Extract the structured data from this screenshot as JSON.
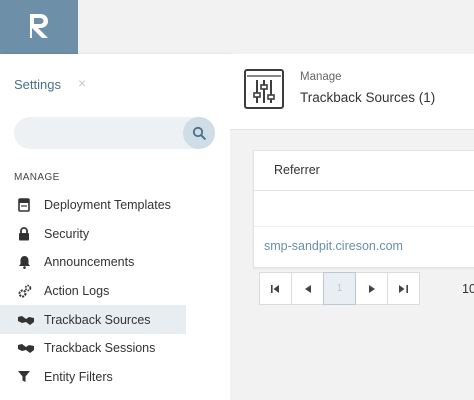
{
  "app": {
    "logo_icon": "r-logo-icon",
    "brand_color": "#6d8fa8"
  },
  "sidebar": {
    "title": "Settings",
    "close_symbol": "×",
    "search_placeholder": "",
    "section_label": "MANAGE",
    "items": [
      {
        "label": "Deployment Templates",
        "icon": "template-icon"
      },
      {
        "label": "Security",
        "icon": "lock-icon"
      },
      {
        "label": "Announcements",
        "icon": "bell-icon"
      },
      {
        "label": "Action Logs",
        "icon": "gears-icon"
      },
      {
        "label": "Trackback Sources",
        "icon": "handshake-icon",
        "active": true
      },
      {
        "label": "Trackback Sessions",
        "icon": "handshake-icon"
      },
      {
        "label": "Entity Filters",
        "icon": "filter-icon"
      }
    ]
  },
  "main": {
    "header": {
      "subtitle": "Manage",
      "title": "Trackback Sources (1)",
      "icon": "sliders-icon"
    },
    "table": {
      "column_header": "Referrer",
      "rows": [
        "smp-sandpit.cireson.com"
      ]
    },
    "pager": {
      "first": "⏮",
      "prev": "◀",
      "current_page": "1",
      "next": "▶",
      "last": "⏭",
      "page_size_partial": "10"
    }
  }
}
